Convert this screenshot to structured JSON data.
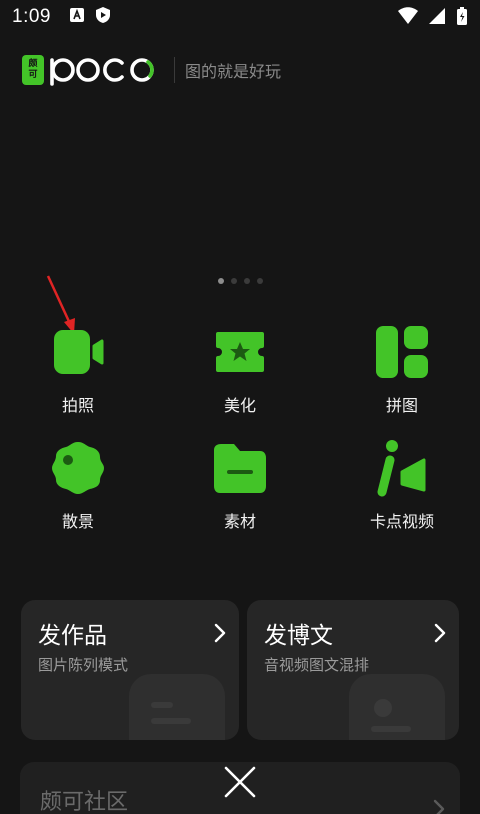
{
  "status": {
    "time": "1:09"
  },
  "header": {
    "logo_cn_top": "颇",
    "logo_cn_bottom": "可",
    "logo_word": "poco",
    "slogan": "图的就是好玩"
  },
  "pager": {
    "count": 4,
    "active": 0
  },
  "tools": [
    {
      "label": "拍照",
      "icon": "camera-video-icon"
    },
    {
      "label": "美化",
      "icon": "star-ticket-icon"
    },
    {
      "label": "拼图",
      "icon": "collage-icon"
    },
    {
      "label": "散景",
      "icon": "bokeh-icon"
    },
    {
      "label": "素材",
      "icon": "folder-icon"
    },
    {
      "label": "卡点视频",
      "icon": "beat-video-icon"
    }
  ],
  "cards": [
    {
      "title": "发作品",
      "subtitle": "图片陈列模式"
    },
    {
      "title": "发博文",
      "subtitle": "音视频图文混排"
    }
  ],
  "community": {
    "title": "颇可社区"
  },
  "colors": {
    "accent": "#43c428",
    "background": "#151515",
    "card": "#262626"
  }
}
